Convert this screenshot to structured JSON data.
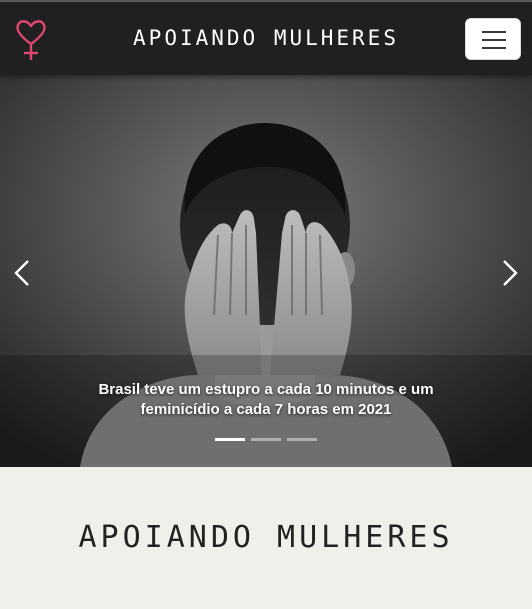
{
  "navbar": {
    "brand": "APOIANDO MULHERES",
    "logo_icon": "female-symbol-heart-icon",
    "toggler_icon": "hamburger-menu-icon",
    "logo_color": "#e0466e"
  },
  "carousel": {
    "caption": "Brasil teve um estupro a cada 10 minutos e um feminicídio a cada 7 horas em 2021",
    "prev_icon": "chevron-left-icon",
    "next_icon": "chevron-right-icon",
    "indicators": 3,
    "active_index": 0
  },
  "section": {
    "title": "APOIANDO MULHERES"
  }
}
